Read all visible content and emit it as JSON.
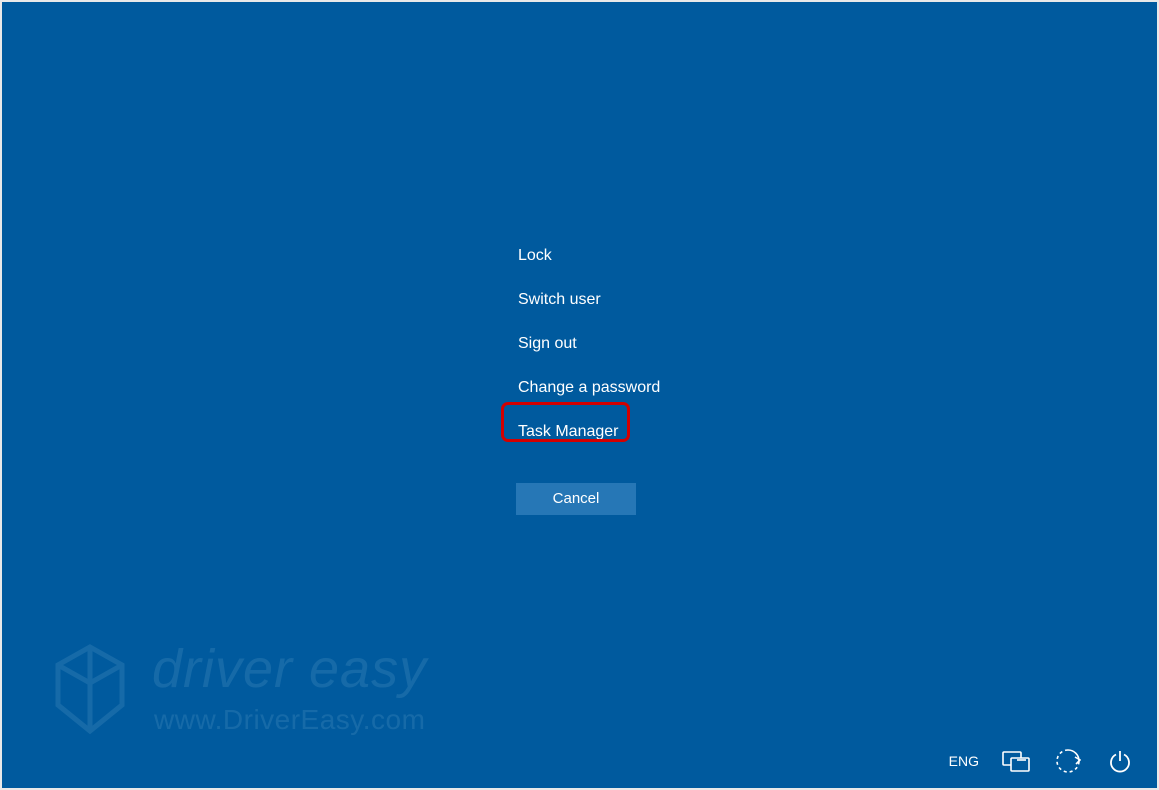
{
  "menu": {
    "items": [
      {
        "label": "Lock"
      },
      {
        "label": "Switch user"
      },
      {
        "label": "Sign out"
      },
      {
        "label": "Change a password"
      },
      {
        "label": "Task Manager"
      }
    ],
    "cancel_label": "Cancel"
  },
  "bottom_bar": {
    "language": "ENG"
  },
  "watermark": {
    "brand": "driver easy",
    "url": "www.DriverEasy.com"
  },
  "annotation": {
    "highlighted_item_index": 4
  },
  "colors": {
    "background": "#005a9e",
    "cancel_bg": "#2677b6",
    "highlight_border": "#d40000"
  }
}
